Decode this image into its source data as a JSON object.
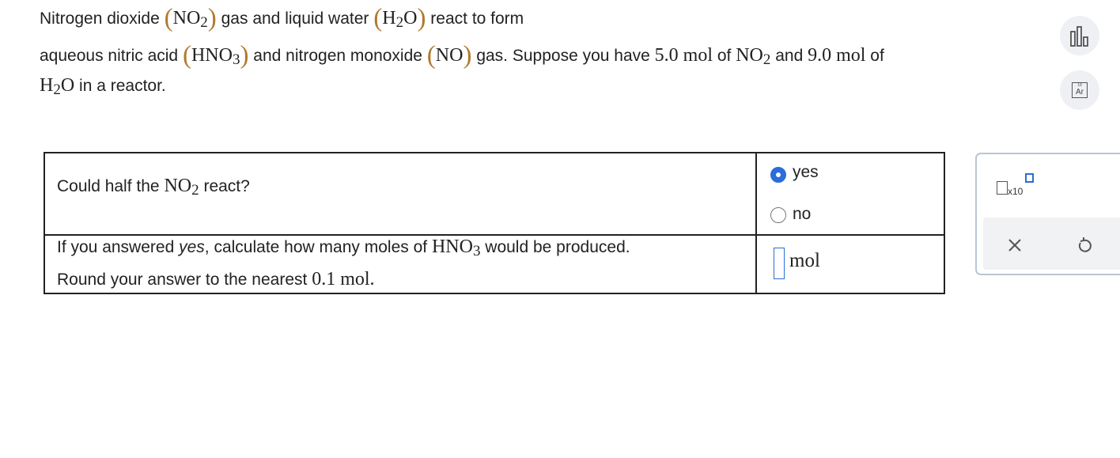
{
  "problem": {
    "l1_a": "Nitrogen dioxide",
    "l1_f1": "NO",
    "l1_f1_sub": "2",
    "l1_b": "gas and liquid water",
    "l1_f2a": "H",
    "l1_f2_sub": "2",
    "l1_f2b": "O",
    "l1_c": "react to form",
    "l2_a": "aqueous nitric acid",
    "l2_f1": "HNO",
    "l2_f1_sub": "3",
    "l2_b": "and nitrogen monoxide",
    "l2_f2": "NO",
    "l2_c": "gas. Suppose you have",
    "l2_amt1": "5.0 mol",
    "l2_d": "of",
    "l2_f3": "NO",
    "l2_f3_sub": "2",
    "l2_e": "and",
    "l2_amt2": "9.0 mol",
    "l2_f": "of",
    "l3_fa": "H",
    "l3_f_sub": "2",
    "l3_fb": "O",
    "l3_a": "in a reactor."
  },
  "table": {
    "q1_a": "Could half the",
    "q1_f": "NO",
    "q1_sub": "2",
    "q1_b": "react?",
    "opt_yes": "yes",
    "opt_no": "no",
    "q2_l1_a": "If you answered",
    "q2_l1_em": "yes",
    "q2_l1_b": ", calculate how many moles of",
    "q2_f": "HNO",
    "q2_sub": "3",
    "q2_l1_c": "would be produced.",
    "q2_l2_a": "Round your answer to the nearest",
    "q2_l2_val": "0.1 mol.",
    "answer_value": "",
    "unit": "mol"
  },
  "tools": {
    "x10": "x10",
    "periodic_number": "18",
    "periodic_symbol": "Ar"
  },
  "colors": {
    "accent": "#2a6ddb",
    "paren": "#b07a2e",
    "panel_border": "#b9c6d4"
  },
  "icons": [
    "chart-icon",
    "periodic-table-icon",
    "superscript-template-icon",
    "close-icon",
    "undo-icon"
  ]
}
